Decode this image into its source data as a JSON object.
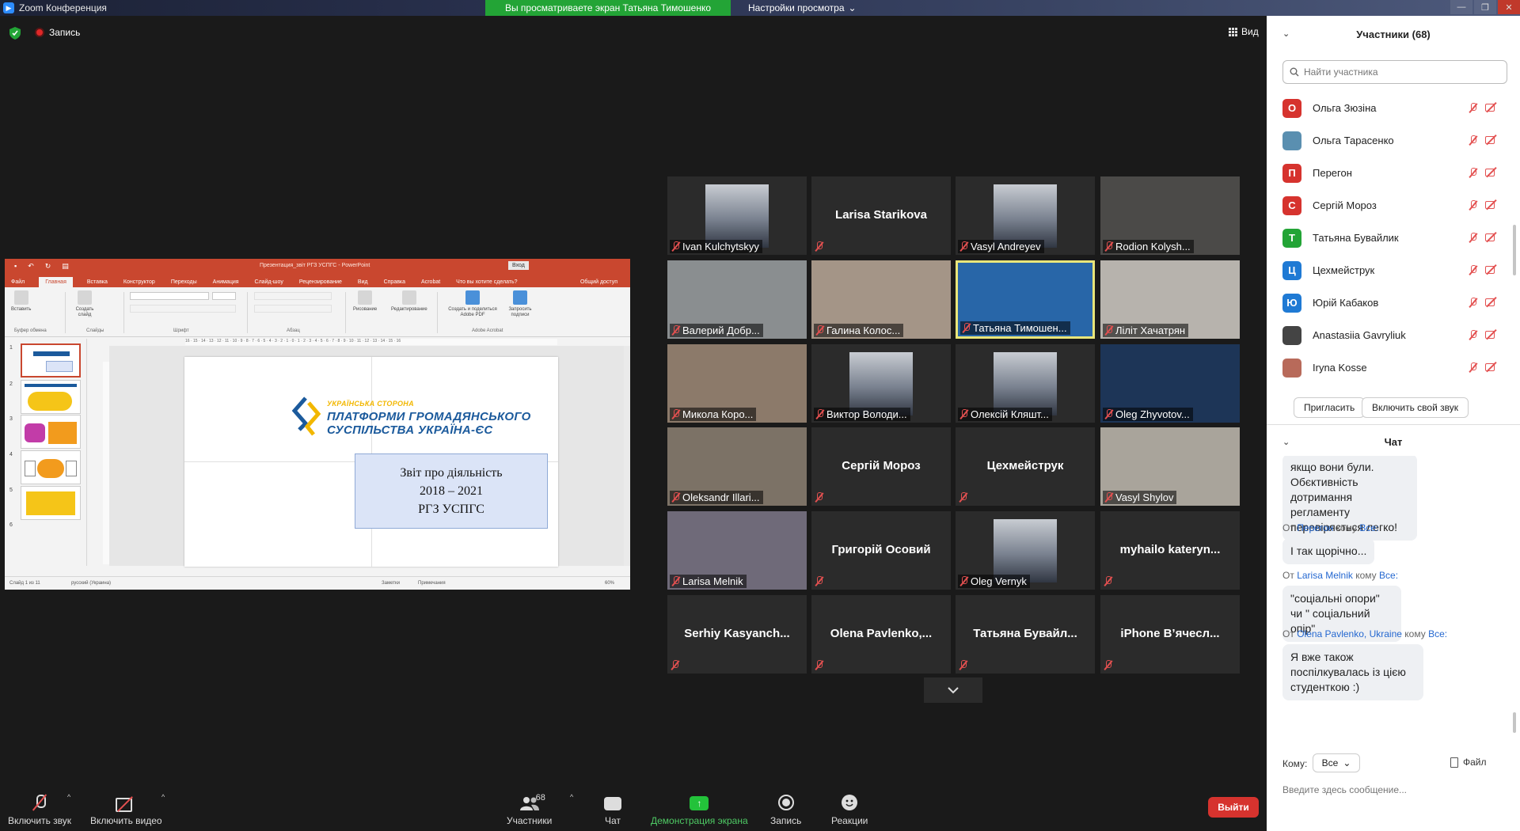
{
  "window": {
    "title": "Zoom Конференция",
    "share_banner": "Вы просматриваете экран Татьяна Тимошенко",
    "view_options": "Настройки просмотра"
  },
  "meeting_top": {
    "recording_label": "Запись",
    "view_label": "Вид"
  },
  "shared_ppt": {
    "document_title": "Презентация_звіт РГЗ УСПГС - PowerPoint",
    "sign_in": "Вход",
    "menu": [
      "Файл",
      "Главная",
      "Вставка",
      "Конструктор",
      "Переходы",
      "Анимация",
      "Слайд-шоу",
      "Рецензирование",
      "Вид",
      "Справка",
      "Acrobat"
    ],
    "tell_me": "Что вы хотите сделать?",
    "share": "Общий доступ",
    "ribbon": {
      "paste": "Вставить",
      "new_slide": "Создать слайд",
      "drawing": "Рисование",
      "editing": "Редактирование",
      "create_pdf": "Создать и поделиться Adobe PDF",
      "request_sign": "Запросить подписи",
      "group_clipboard": "Буфер обмена",
      "group_slides": "Слайды",
      "group_font": "Шрифт",
      "group_paragraph": "Абзац",
      "group_acrobat": "Adobe Acrobat"
    },
    "ruler": "16 · 15 · 14 · 13 · 12 · 11 · 10 · 9 · 8 · 7 · 6 · 5 · 4 · 3 · 2 · 1 · 0 · 1 · 2 · 3 · 4 · 5 · 6 · 7 · 8 · 9 · 10 · 11 · 12 · 13 · 14 · 15 · 16",
    "thumb_numbers": [
      "1",
      "2",
      "3",
      "4",
      "5",
      "6"
    ],
    "slide": {
      "kicker": "УКРАЇНСЬКА СТОРОНА",
      "line1": "ПЛАТФОРМИ ГРОМАДЯНСЬКОГО",
      "line2": "СУСПІЛЬСТВА УКРАЇНА-ЄС",
      "box_line1": "Звіт про діяльність",
      "box_line2": "2018 – 2021",
      "box_line3": "РГЗ УСПГС"
    },
    "status": {
      "slide_of": "Слайд 1 из 11",
      "language": "русский (Украина)",
      "notes": "Заметки",
      "comments": "Примечания",
      "zoom": "60%"
    }
  },
  "video_tiles": [
    {
      "name": "Ivan Kulchytskyy",
      "kind": "video",
      "color": "#2b2b2b"
    },
    {
      "name": "Larisa Starikova",
      "kind": "name"
    },
    {
      "name": "Vasyl Andreyev",
      "kind": "video",
      "color": "#2b2b2b"
    },
    {
      "name": "Rodion Kolysh...",
      "kind": "video",
      "color": "#4b4a48"
    },
    {
      "name": "Валерий Добр...",
      "kind": "video",
      "color": "#8a8e90"
    },
    {
      "name": "Галина Колос...",
      "kind": "video",
      "color": "#a49587"
    },
    {
      "name": "Татьяна Тимошен...",
      "kind": "video",
      "color": "#2866a8",
      "active": true
    },
    {
      "name": "Лілiт Хачатрян",
      "kind": "video",
      "color": "#b7b3ad"
    },
    {
      "name": "Микола Коро...",
      "kind": "video",
      "color": "#8c7a6a"
    },
    {
      "name": "Виктор Володи...",
      "kind": "video",
      "color": "#2b2b2b"
    },
    {
      "name": "Олексій Кляшт...",
      "kind": "video",
      "color": "#2b2b2b"
    },
    {
      "name": "Oleg Zhyvotov...",
      "kind": "video",
      "color": "#1d3557"
    },
    {
      "name": "Oleksandr Illari...",
      "kind": "video",
      "color": "#7c7266"
    },
    {
      "name": "Сергій Мороз",
      "kind": "name"
    },
    {
      "name": "Цехмейструк",
      "kind": "name"
    },
    {
      "name": "Vasyl Shylov",
      "kind": "video",
      "color": "#a9a49b"
    },
    {
      "name": "Larisa Melnik",
      "kind": "video",
      "color": "#6f6a79"
    },
    {
      "name": "Григорій Осовий",
      "kind": "name"
    },
    {
      "name": "Oleg Vernyk",
      "kind": "video",
      "color": "#2b2b2b"
    },
    {
      "name": "myhailo katеryn...",
      "kind": "name"
    },
    {
      "name": "Serhiy Kasyanch...",
      "kind": "name"
    },
    {
      "name": "Olena Pavlenko,...",
      "kind": "name"
    },
    {
      "name": "Татьяна Бувайл...",
      "kind": "name"
    },
    {
      "name": "iPhone В’ячесл...",
      "kind": "name"
    }
  ],
  "participants_panel": {
    "title": "Участники (68)",
    "search_placeholder": "Найти участника",
    "items": [
      {
        "name": "Ольга Зюзіна",
        "initial": "О",
        "color": "#d6332e"
      },
      {
        "name": "Ольга Тарасенко",
        "initial": "",
        "color": "#5a8fb0"
      },
      {
        "name": "Перегон",
        "initial": "П",
        "color": "#d6332e"
      },
      {
        "name": "Сергій Мороз",
        "initial": "С",
        "color": "#d6332e"
      },
      {
        "name": "Татьяна Бувайлик",
        "initial": "Т",
        "color": "#23a436"
      },
      {
        "name": "Цехмейструк",
        "initial": "Ц",
        "color": "#1f7ad4"
      },
      {
        "name": "Юрій Кабаков",
        "initial": "Ю",
        "color": "#1f7ad4"
      },
      {
        "name": "Anastasiia Gavryliuk",
        "initial": "",
        "color": "#444"
      },
      {
        "name": "Iryna Kosse",
        "initial": "",
        "color": "#b86a5a"
      }
    ],
    "invite": "Пригласить",
    "unmute_me": "Включить свой звук"
  },
  "chat": {
    "title": "Чат",
    "messages": [
      {
        "meta_from": "",
        "meta_to": "",
        "text": "якщо вони були. Обєктивність дотримання регламенту перевіряється легко!"
      },
      {
        "meta_from": "Перегон",
        "meta_to": "Все:",
        "text": "І так щорічно..."
      },
      {
        "meta_from": "Larisa Melnik",
        "meta_to": "Все:",
        "text": "\"соціальні опори\"  чи \" соціальний опір\""
      },
      {
        "meta_from": "Olena Pavlenko, Ukraine",
        "meta_to": "Все:",
        "text": "Я вже також поспілкувалась із цією студенткою :)"
      }
    ],
    "from_prefix": "От",
    "to_word": "кому",
    "to_label": "Кому:",
    "to_value": "Все",
    "file_label": "Файл",
    "input_placeholder": "Введите здесь сообщение..."
  },
  "toolbar": {
    "audio": "Включить звук",
    "video": "Включить видео",
    "participants": "Участники",
    "participants_count": "68",
    "chat": "Чат",
    "share": "Демонстрация экрана",
    "record": "Запись",
    "reactions": "Реакции",
    "leave": "Выйти"
  }
}
